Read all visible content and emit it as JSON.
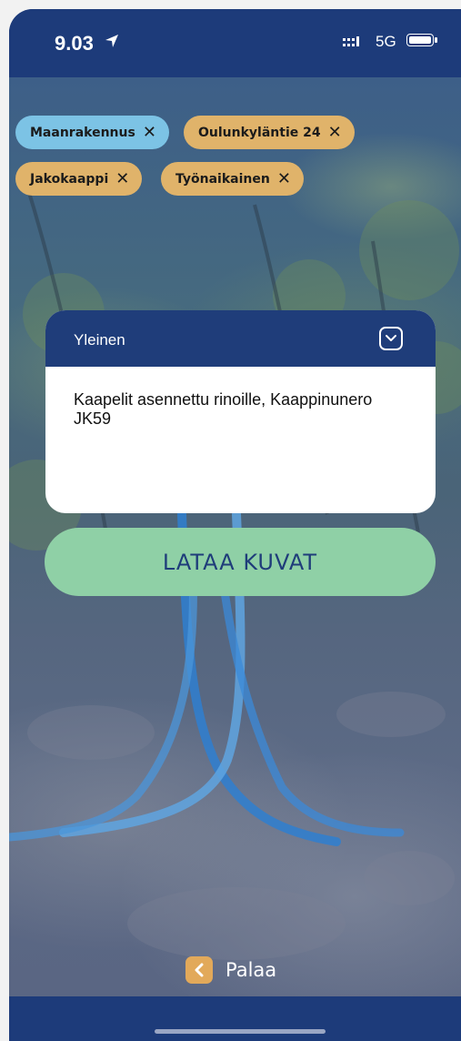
{
  "status_bar": {
    "time": "9.03",
    "network": "5G"
  },
  "tags": [
    {
      "label": "Maanrakennus",
      "color": "#7cc3e5"
    },
    {
      "label": "Oulunkyläntie 24",
      "color": "#e0b36a"
    },
    {
      "label": "Jakokaappi",
      "color": "#e0b36a"
    },
    {
      "label": "Työnaikainen",
      "color": "#e0b36a"
    }
  ],
  "tag_remove_symbol": "✕",
  "card": {
    "title": "Yleinen",
    "note": "Kaapelit asennettu rinoille, Kaappinunero JK59"
  },
  "upload_button": {
    "label": "LATAA KUVAT"
  },
  "back_link": {
    "label": "Palaa"
  },
  "colors": {
    "primary": "#1d3b7a",
    "accent_green": "#8fd0a6",
    "accent_orange": "#e2a95a",
    "accent_blue": "#7cc3e5"
  }
}
